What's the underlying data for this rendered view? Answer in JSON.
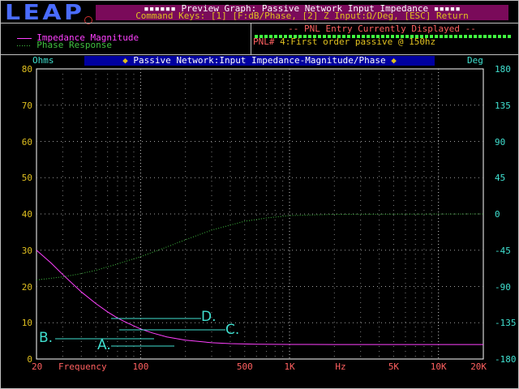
{
  "app": {
    "logo_text": "LEAP"
  },
  "header": {
    "title_line": "Preview Graph: Passive Network Input Impedance",
    "commands_line": "Command Keys: [1] [F:dB/Phase, [2] Z Input:Ω/Deg, [ESC] Return",
    "title_deco": "▪▪▪▪▪▪",
    "title_deco_right": "▪▪▪▪▪"
  },
  "legend": [
    {
      "label": "Impedance Magnitude",
      "color": "#ff40ff",
      "style": "solid"
    },
    {
      "label": "Phase Response",
      "color": "#40c040",
      "style": "dotted"
    }
  ],
  "pnl": {
    "title": "-- PNL Entry Currently Displayed --",
    "prefix": "PNL#",
    "number": "4",
    "description": ":First order passive @ 150hz"
  },
  "graph": {
    "title": "Passive Network:Input Impedance-Magnitude/Phase",
    "title_marker_left": "◆",
    "title_marker_right": "◆",
    "left_unit": "Ohms",
    "right_unit": "Deg"
  },
  "chart_data": {
    "type": "line",
    "x_scale": "log",
    "xlim": [
      20,
      20000
    ],
    "ylim_left": [
      0,
      80
    ],
    "ylim_right": [
      -180,
      180
    ],
    "left_ticks": [
      "0",
      "10",
      "20",
      "30",
      "40",
      "50",
      "60",
      "70",
      "80"
    ],
    "right_ticks": [
      "-180",
      "-135",
      "-90",
      "-45",
      "0",
      "45",
      "90",
      "135",
      "180"
    ],
    "x_tick_labels": [
      {
        "label": "20",
        "freq": 20,
        "color": "#ff6060"
      },
      {
        "label": "Frequency",
        "freq": 35,
        "color": "#ff6060"
      },
      {
        "label": "100",
        "freq": 100,
        "color": "#ff6060"
      },
      {
        "label": "500",
        "freq": 500,
        "color": "#ff6060"
      },
      {
        "label": "1K",
        "freq": 1000,
        "color": "#ff6060"
      },
      {
        "label": "Hz",
        "freq": 2200,
        "color": "#ff6060"
      },
      {
        "label": "5K",
        "freq": 5000,
        "color": "#ff6060"
      },
      {
        "label": "10K",
        "freq": 10000,
        "color": "#ff6060"
      },
      {
        "label": "20K",
        "freq": 20000,
        "color": "#ff6060"
      }
    ],
    "grid": true,
    "series": [
      {
        "name": "Impedance Magnitude",
        "axis": "left",
        "color": "#ff40ff",
        "style": "solid",
        "points": [
          [
            20,
            30
          ],
          [
            25,
            26.5
          ],
          [
            30,
            23.3
          ],
          [
            40,
            18.5
          ],
          [
            50,
            15.3
          ],
          [
            60,
            13.0
          ],
          [
            70,
            11.3
          ],
          [
            80,
            10.1
          ],
          [
            100,
            8.3
          ],
          [
            120,
            7.2
          ],
          [
            150,
            6.1
          ],
          [
            200,
            5.2
          ],
          [
            300,
            4.5
          ],
          [
            400,
            4.25
          ],
          [
            600,
            4.1
          ],
          [
            1000,
            4.02
          ],
          [
            2000,
            4.0
          ],
          [
            20000,
            4.0
          ]
        ]
      },
      {
        "name": "Phase Response",
        "axis": "right",
        "color": "#40c040",
        "style": "dotted",
        "points": [
          [
            20,
            -82
          ],
          [
            30,
            -78
          ],
          [
            40,
            -74
          ],
          [
            50,
            -70
          ],
          [
            70,
            -62
          ],
          [
            100,
            -53
          ],
          [
            150,
            -41
          ],
          [
            200,
            -32
          ],
          [
            300,
            -20
          ],
          [
            500,
            -9
          ],
          [
            700,
            -5
          ],
          [
            1000,
            -2
          ],
          [
            2000,
            -0.5
          ],
          [
            20000,
            0
          ]
        ]
      }
    ]
  },
  "callouts": [
    {
      "label": "A.",
      "target": "impedance-curve"
    },
    {
      "label": "B.",
      "target": "impedance-curve"
    },
    {
      "label": "C.",
      "target": "impedance-curve"
    },
    {
      "label": "D.",
      "target": "impedance-curve"
    }
  ]
}
